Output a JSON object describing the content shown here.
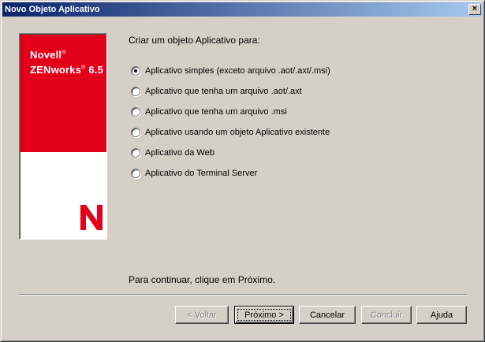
{
  "window": {
    "title": "Novo Objeto Aplicativo",
    "close_glyph": "×"
  },
  "logo": {
    "brand": "Novell",
    "product": "ZENworks",
    "version": "6.5",
    "reg_mark": "®",
    "emblem_letter": "N",
    "colors": {
      "red": "#e3001b",
      "white": "#ffffff"
    }
  },
  "heading": "Criar um objeto Aplicativo para:",
  "options": [
    {
      "label": "Aplicativo simples (exceto arquivo .aot/.axt/.msi)",
      "checked": true
    },
    {
      "label": "Aplicativo que tenha um arquivo .aot/.axt",
      "checked": false
    },
    {
      "label": "Aplicativo que tenha um arquivo .msi",
      "checked": false
    },
    {
      "label": "Aplicativo usando um objeto Aplicativo existente",
      "checked": false
    },
    {
      "label": "Aplicativo da Web",
      "checked": false
    },
    {
      "label": "Aplicativo do Terminal Server",
      "checked": false
    }
  ],
  "footer_text": "Para continuar, clique em Próximo.",
  "buttons": {
    "back": "< Voltar",
    "next": "Próximo >",
    "cancel": "Cancelar",
    "finish": "Concluir",
    "help": "Ajuda"
  }
}
